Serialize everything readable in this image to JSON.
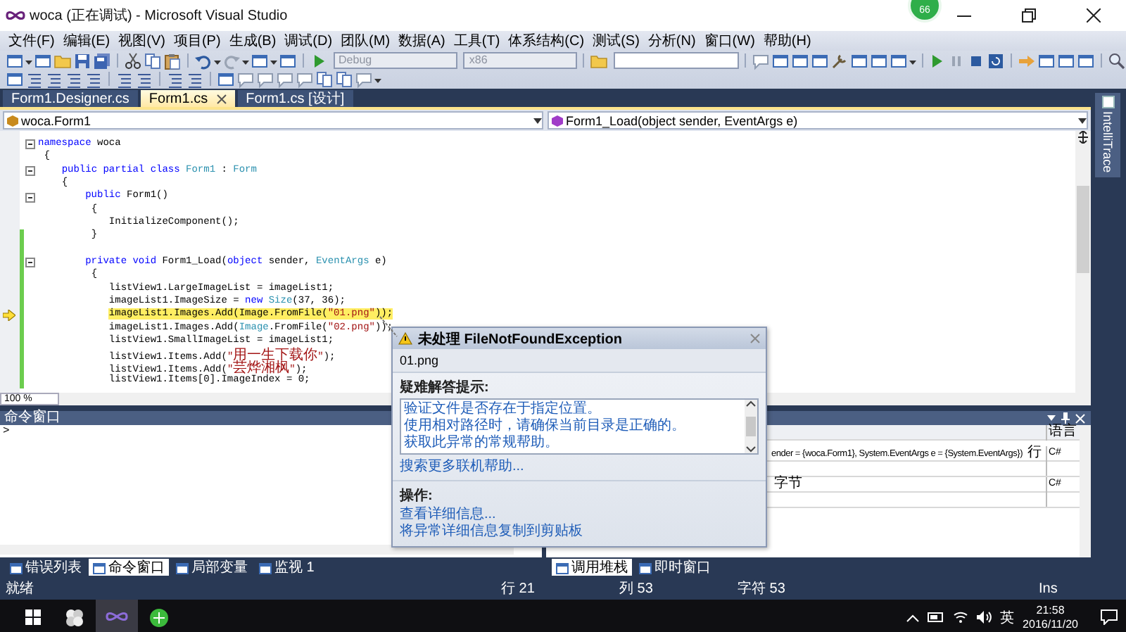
{
  "window": {
    "title": "woca (正在调试) - Microsoft Visual Studio"
  },
  "notification_badge": "66",
  "menu": [
    "文件(F)",
    "编辑(E)",
    "视图(V)",
    "项目(P)",
    "生成(B)",
    "调试(D)",
    "团队(M)",
    "数据(A)",
    "工具(T)",
    "体系结构(C)",
    "测试(S)",
    "分析(N)",
    "窗口(W)",
    "帮助(H)"
  ],
  "toolbar": {
    "combos": [
      {
        "value": "Debug",
        "disabled": true
      },
      {
        "value": "x86",
        "disabled": true
      }
    ]
  },
  "doc_tabs": [
    {
      "label": "Form1.Designer.cs",
      "selected": false
    },
    {
      "label": "Form1.cs",
      "selected": true
    },
    {
      "label": "Form1.cs [设计]",
      "selected": false
    }
  ],
  "editor": {
    "type_combo": "woca.Form1",
    "member_combo": "Form1_Load(object sender, EventArgs e)",
    "zoom": "100 %",
    "lines": [
      {
        "tokens": [
          {
            "kind": "keyword",
            "text": "namespace"
          },
          {
            "kind": "plain",
            "text": " woca"
          }
        ],
        "current": false,
        "changed": false,
        "fold": true
      },
      {
        "tokens": [
          {
            "kind": "plain",
            "text": " {"
          }
        ],
        "current": false,
        "changed": false,
        "fold": false
      },
      {
        "tokens": [
          {
            "kind": "keyword",
            "text": "    public partial class "
          },
          {
            "kind": "type",
            "text": "Form1"
          },
          {
            "kind": "plain",
            "text": " : "
          },
          {
            "kind": "type",
            "text": "Form"
          }
        ],
        "current": false,
        "changed": false,
        "fold": true
      },
      {
        "tokens": [
          {
            "kind": "plain",
            "text": "    {"
          }
        ],
        "current": false,
        "changed": false,
        "fold": false
      },
      {
        "tokens": [
          {
            "kind": "keyword",
            "text": "        public"
          },
          {
            "kind": "plain",
            "text": " Form1()"
          }
        ],
        "current": false,
        "changed": false,
        "fold": true
      },
      {
        "tokens": [
          {
            "kind": "plain",
            "text": "         {"
          }
        ],
        "current": false,
        "changed": false,
        "fold": false
      },
      {
        "tokens": [
          {
            "kind": "plain",
            "text": "            InitializeComponent();"
          }
        ],
        "current": false,
        "changed": false,
        "fold": false
      },
      {
        "tokens": [
          {
            "kind": "plain",
            "text": "         }"
          }
        ],
        "current": false,
        "changed": true,
        "fold": false
      },
      {
        "current": false,
        "changed": true,
        "fold": false
      },
      {
        "tokens": [
          {
            "kind": "keyword",
            "text": "        private void "
          },
          {
            "kind": "plain",
            "text": "Form1_Load("
          },
          {
            "kind": "keyword",
            "text": "object"
          },
          {
            "kind": "plain",
            "text": " sender, "
          },
          {
            "kind": "type",
            "text": "EventArgs"
          },
          {
            "kind": "plain",
            "text": " e)"
          }
        ],
        "current": false,
        "changed": true,
        "fold": true
      },
      {
        "tokens": [
          {
            "kind": "plain",
            "text": "         {"
          }
        ],
        "current": false,
        "changed": true,
        "fold": false
      },
      {
        "tokens": [
          {
            "kind": "plain",
            "text": "            listView1.LargeImageList = imageList1;"
          }
        ],
        "current": false,
        "changed": true,
        "fold": false
      },
      {
        "tokens": [
          {
            "kind": "plain",
            "text": "            imageList1.ImageSize = "
          },
          {
            "kind": "keyword",
            "text": "new "
          },
          {
            "kind": "type",
            "text": "Size"
          },
          {
            "kind": "plain",
            "text": "(37, 36);"
          }
        ],
        "current": false,
        "changed": true,
        "fold": false
      },
      {
        "tokens": [
          {
            "kind": "plain",
            "text": "            imageList1.Images.Add(Image.FromFile("
          },
          {
            "kind": "string",
            "text": "\"01.png\""
          },
          {
            "kind": "plain",
            "text": "));"
          }
        ],
        "current": true,
        "changed": true,
        "fold": false
      },
      {
        "tokens": [
          {
            "kind": "plain",
            "text": "            imageList1.Images.Add("
          },
          {
            "kind": "type",
            "text": "Image"
          },
          {
            "kind": "plain",
            "text": ".FromFile("
          },
          {
            "kind": "string",
            "text": "\"02.png\""
          },
          {
            "kind": "plain",
            "text": "));"
          }
        ],
        "current": false,
        "changed": true,
        "fold": false
      },
      {
        "tokens": [
          {
            "kind": "plain",
            "text": "            listView1.SmallImageList = imageList1;"
          }
        ],
        "current": false,
        "changed": true,
        "fold": false
      },
      {
        "tokens": [
          {
            "kind": "plain",
            "text": "            listView1.Items.Add("
          },
          {
            "kind": "string",
            "text": "\"用一生下载你\""
          },
          {
            "kind": "plain",
            "text": ");"
          }
        ],
        "current": false,
        "changed": true,
        "fold": false
      },
      {
        "tokens": [
          {
            "kind": "plain",
            "text": "            listView1.Items.Add("
          },
          {
            "kind": "string",
            "text": "\"芸烨湘枫\""
          },
          {
            "kind": "plain",
            "text": ");"
          }
        ],
        "current": false,
        "changed": true,
        "fold": false
      },
      {
        "tokens": [
          {
            "kind": "plain",
            "text": "            listView1.Items[0].ImageIndex = 0;"
          }
        ],
        "current": false,
        "changed": true,
        "fold": false
      }
    ]
  },
  "exception": {
    "title": "未处理 FileNotFoundException",
    "message": "01.png",
    "hints_label": "疑难解答提示:",
    "hints": [
      "验证文件是否存在于指定位置。",
      "使用相对路径时，请确保当前目录是正确的。",
      "获取此异常的常规帮助。"
    ],
    "search_link": "搜索更多联机帮助...",
    "actions_label": "操作:",
    "actions": [
      "查看详细信息...",
      "将异常详细信息复制到剪贴板"
    ]
  },
  "command_window": {
    "title": "命令窗口",
    "prompt": ">"
  },
  "call_stack": {
    "language_header": "语言",
    "rows": [
      {
        "name": "ender = {woca.Form1}, System.EventArgs e = {System.EventArgs}) 行",
        "language": "C#"
      },
      {
        "name": "字节",
        "language": "C#"
      }
    ]
  },
  "bottom_tabs_left": [
    {
      "label": "错误列表",
      "selected": false
    },
    {
      "label": "命令窗口",
      "selected": true
    },
    {
      "label": "局部变量",
      "selected": false
    },
    {
      "label": "监视 1",
      "selected": false
    }
  ],
  "bottom_tabs_right": [
    {
      "label": "调用堆栈",
      "selected": true
    },
    {
      "label": "即时窗口",
      "selected": false
    }
  ],
  "side_tab": "IntelliTrace",
  "status_bar": {
    "message": "就绪",
    "line": "行 21",
    "column": "列 53",
    "char": "字符 53",
    "mode": "Ins"
  },
  "taskbar": {
    "input_method": "英",
    "time": "21:58",
    "date": "2016/11/20"
  }
}
